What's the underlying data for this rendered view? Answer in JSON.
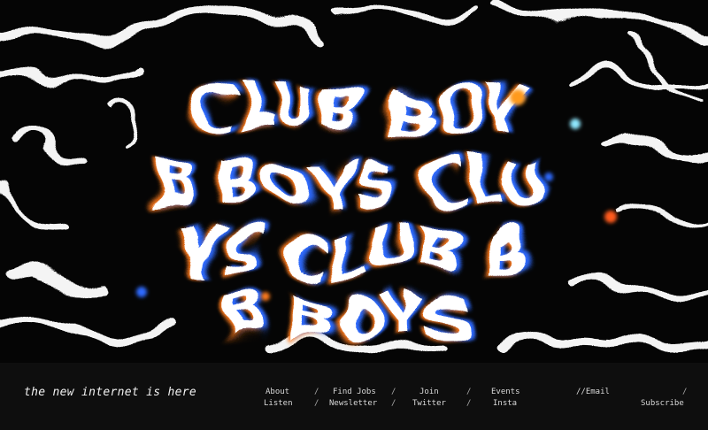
{
  "hero": {
    "lines": [
      "CLUB BOY",
      "B BOYS CLU",
      "YS CLUB B",
      "B BOYS"
    ],
    "colors": {
      "background": "#050505",
      "ink": "#ffffff",
      "glow_orange": "#ff7a1a",
      "glow_blue": "#2e6bff",
      "glow_cyan": "#8fe8ff"
    }
  },
  "footer": {
    "tagline": "the new internet is here",
    "separator": "/",
    "links_top": [
      "About",
      "Find Jobs",
      "Join",
      "Events",
      "//Email"
    ],
    "links_bottom": [
      "Listen",
      "Newsletter",
      "Twitter",
      "Insta",
      "Subscribe"
    ]
  }
}
